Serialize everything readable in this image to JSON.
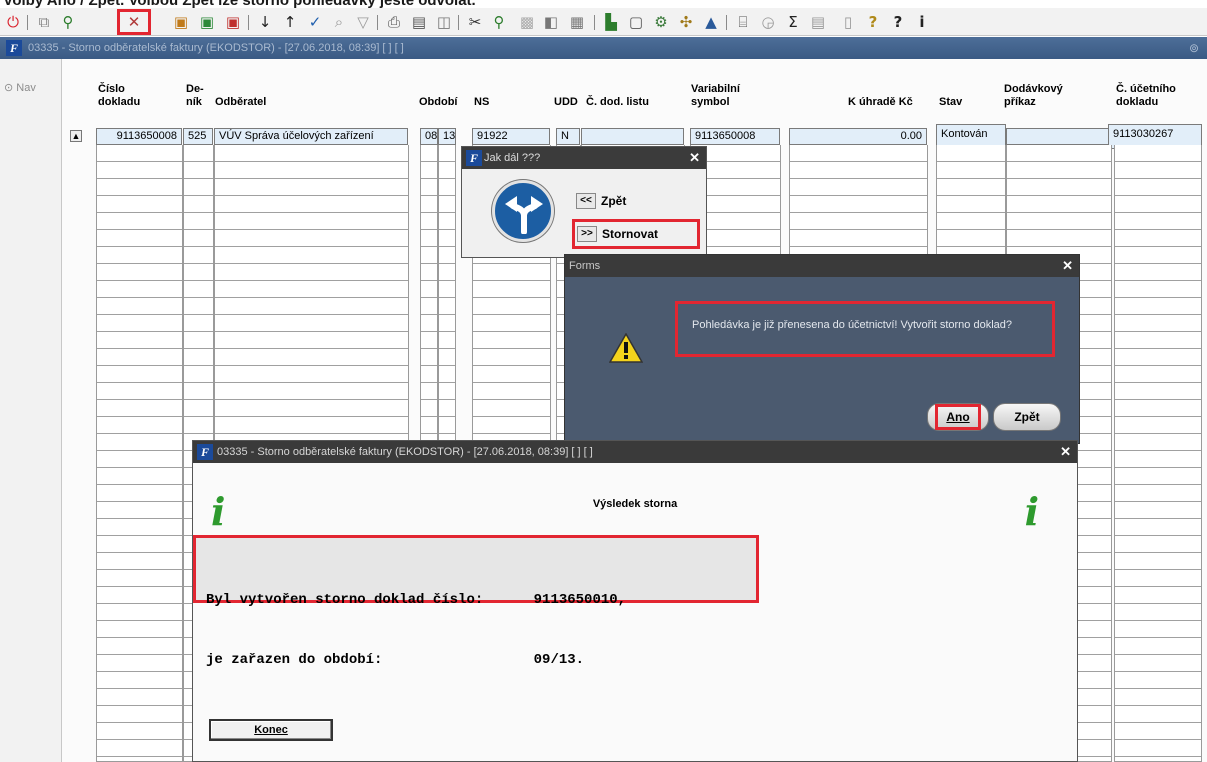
{
  "caption": "volby Ano / Zpět. Volbou Zpět lze storno pohledávky ještě odvolat.",
  "toolbar": {
    "icons": [
      "power-icon",
      "copy-icon",
      "find-icon",
      "cancel-document-icon",
      "record-icon",
      "record-add-icon",
      "record-delete-icon",
      "sort-asc-icon",
      "sort-desc-icon",
      "check-icon",
      "query-icon",
      "filter-icon",
      "print-icon",
      "preview-icon",
      "export-icon",
      "scissors-icon",
      "attach-icon",
      "image-icon",
      "chart-icon",
      "grid-icon",
      "folder-icon",
      "save-icon",
      "settings-icon",
      "sigma-icon",
      "calc-icon",
      "help-icon",
      "about-icon",
      "info-icon"
    ]
  },
  "window": {
    "title": "03335 - Storno odběratelské faktury (EKODSTOR) - [27.06.2018, 08:39] [ ] [ ]"
  },
  "nav": {
    "label": "Nav"
  },
  "columns": {
    "cislo": "Číslo dokladu",
    "denik": "De- ník",
    "odberatel": "Odběratel",
    "obdobi": "Období",
    "ns": "NS",
    "udd": "UDD",
    "dodlist": "Č. dod. listu",
    "varsym": "Variabilní symbol",
    "kuhrade": "K úhradě Kč",
    "stav": "Stav",
    "dodprikaz": "Dodávkový příkaz",
    "ucdoklad": "Č. účetního dokladu"
  },
  "row": {
    "cislo": "9113650008",
    "denik": "525",
    "odberatel": "VÚV Správa účelových zařízení",
    "obdobi_m": "08",
    "obdobi_y": "13",
    "ns": "91922",
    "udd": "N",
    "varsym": "9113650008",
    "kuhrade": "0.00",
    "stav": "Kontován",
    "ucdoklad": "9113030267"
  },
  "dialog_jak": {
    "title": "Jak dál ???",
    "back_glyph": "<<",
    "back_label": "Zpět",
    "storno_glyph": ">>",
    "storno_label": "Stornovat"
  },
  "dialog_forms": {
    "title": "Forms",
    "message": "Pohledávka je již přenesena do účetnictví! Vytvořit storno doklad?",
    "yes_label": "Ano",
    "back_label": "Zpět"
  },
  "dialog_result": {
    "title": "03335 - Storno odběratelské faktury (EKODSTOR) - [27.06.2018, 08:39] [ ] [ ]",
    "heading": "Výsledek storna",
    "line1": "Byl vytvořen storno doklad číslo:      9113650010,",
    "line2": "je zařazen do období:                  09/13.",
    "close_label": "Konec"
  },
  "colors": {
    "highlight": "#e22631",
    "titlebar": "#3a5a84",
    "forms_bg": "#4b5a6f",
    "info_green": "#2e9a2e"
  }
}
